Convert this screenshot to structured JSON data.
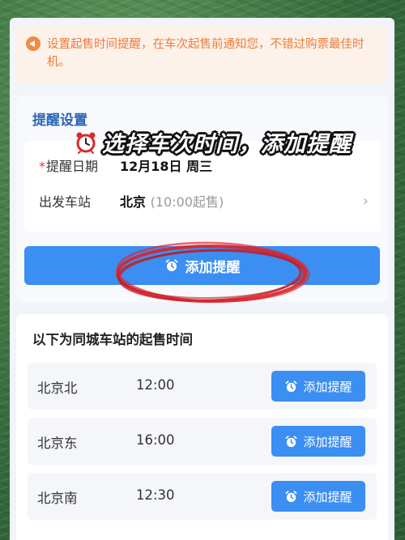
{
  "notice": {
    "text": "设置起售时间提醒，在车次起售前通知您，不错过购票最佳时机。",
    "icon": "megaphone-icon",
    "color": "#ef7a3a"
  },
  "reminder_settings": {
    "title": "提醒设置",
    "date_label_required": "*",
    "date_label": "提醒日期",
    "date_value": "12月18日 周三",
    "station_label": "出发车站",
    "station_value": "北京",
    "station_sale_time": "(10:00起售)",
    "add_button_label": "添加提醒"
  },
  "overlay_caption": {
    "text": "选择车次时间，添加提醒",
    "icon": "alarm-clock-icon"
  },
  "same_city": {
    "title": "以下为同城车站的起售时间",
    "stations": [
      {
        "name": "北京北",
        "time": "12:00",
        "button": "添加提醒"
      },
      {
        "name": "北京东",
        "time": "16:00",
        "button": "添加提醒"
      },
      {
        "name": "北京南",
        "time": "12:30",
        "button": "添加提醒"
      }
    ]
  },
  "colors": {
    "accent": "#3b8ef2",
    "section_title": "#2c64b6",
    "highlight_scribble": "#d8232a",
    "background_frame": "#3e7446"
  }
}
